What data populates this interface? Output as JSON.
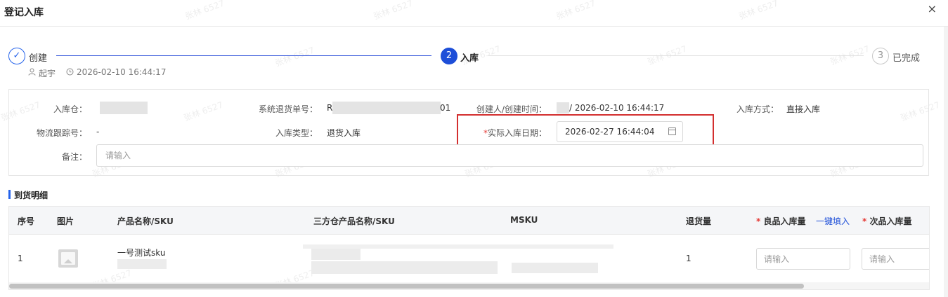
{
  "dialog": {
    "title": "登记入库",
    "close_glyph": "×"
  },
  "steps": [
    {
      "index": "✓",
      "label": "创建",
      "status": "done"
    },
    {
      "index": "2",
      "label": "入库",
      "status": "active"
    },
    {
      "index": "3",
      "label": "已完成",
      "status": "todo"
    }
  ],
  "step_meta": {
    "user": "起宇",
    "time": "2026-02-10 16:44:17"
  },
  "info": {
    "warehouse_label": "入库仓：",
    "return_no_label": "系统退货单号：",
    "return_no_prefix": "R",
    "return_no_suffix": "01",
    "creator_label": "创建人/创建时间：",
    "creator_value": "/ 2026-02-10 16:44:17",
    "method_label": "入库方式：",
    "method_value": "直接入库",
    "tracking_label": "物流跟踪号：",
    "tracking_value": "-",
    "type_label": "入库类型：",
    "type_value": "退货入库",
    "actual_date_star": "*",
    "actual_date_label": "实际入库日期：",
    "actual_date_value": "2026-02-27 16:44:04",
    "remark_label": "备注：",
    "remark_placeholder": "请输入"
  },
  "section": {
    "title": "到货明细"
  },
  "table": {
    "headers": {
      "no": "序号",
      "image": "图片",
      "product": "产品名称/SKU",
      "third_party": "三方仓产品名称/SKU",
      "msku": "MSKU",
      "return_qty": "退货量",
      "good_star": "*",
      "good_qty": "良品入库量",
      "fill_link": "一键填入",
      "defect_star": "*",
      "defect_qty": "次品入库量"
    },
    "rows": [
      {
        "no": "1",
        "product_name": "一号测试sku",
        "return_qty": "1",
        "good_placeholder": "请输入",
        "defect_placeholder": "请输入"
      }
    ]
  },
  "watermark": "张林 6527",
  "colors": {
    "primary": "#1d4ed8",
    "highlight": "#d32f2f",
    "required": "#e53935"
  }
}
